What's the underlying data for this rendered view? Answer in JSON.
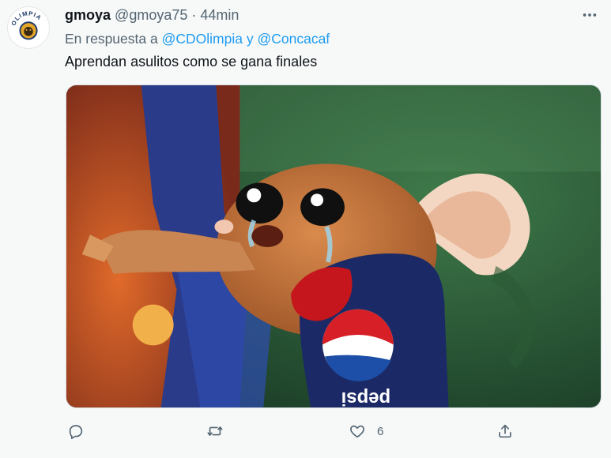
{
  "tweet": {
    "display_name": "gmoya",
    "handle": "@gmoya75",
    "separator": "·",
    "time": "44min",
    "reply_prefix": "En respuesta a",
    "reply_to_1": "@CDOlimpia",
    "reply_joiner": "y",
    "reply_to_2": "@Concacaf",
    "text": "Aprendan asulitos como se gana finales",
    "avatar_logo_text": "OLIMPIA",
    "media_text": "pepsi"
  },
  "actions": {
    "reply_count": "",
    "retweet_count": "",
    "like_count": "6",
    "share_count": ""
  },
  "icons": {
    "more": "more-horizontal-icon",
    "reply": "reply-icon",
    "retweet": "retweet-icon",
    "like": "heart-icon",
    "share": "share-icon"
  },
  "colors": {
    "link": "#1d9bf0",
    "secondary_text": "#536471",
    "primary_text": "#0f1419"
  }
}
